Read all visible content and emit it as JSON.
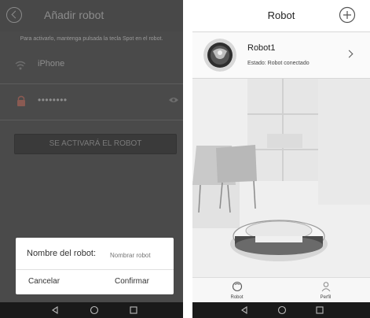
{
  "left_screen": {
    "header": {
      "title": "Añadir robot",
      "back_icon": "back-circle-icon"
    },
    "instruction": "Para activarlo, mantenga pulsada la tecla Spot en el robot.",
    "wifi": {
      "icon": "wifi-icon",
      "ssid": "iPhone"
    },
    "password": {
      "icon": "lock-icon",
      "value": "••••••••",
      "toggle_icon": "eye-icon"
    },
    "activate_button": "SE ACTIVARÁ EL ROBOT",
    "dialog": {
      "label": "Nombre del robot:",
      "input_placeholder": "Nombrar robot",
      "cancel": "Cancelar",
      "confirm": "Confirmar"
    },
    "nav_bar": [
      "back-triangle-icon",
      "home-circle-icon",
      "recents-square-icon"
    ]
  },
  "right_screen": {
    "header": {
      "title": "Robot",
      "add_icon": "plus-circle-icon"
    },
    "robot": {
      "name": "Robot1",
      "status": "Estado: Robot conectado",
      "chevron_icon": "chevron-right-icon"
    },
    "tabs": [
      {
        "label": "Robot",
        "icon": "robot-icon"
      },
      {
        "label": "Perfil",
        "icon": "person-icon"
      }
    ],
    "nav_bar": [
      "back-triangle-icon",
      "home-circle-icon",
      "recents-square-icon"
    ]
  },
  "colors": {
    "left_background": "#4a4a4a",
    "dialog_background": "#ffffff",
    "right_header": "#ffffff",
    "nav_bar": "#1a1a1a"
  }
}
